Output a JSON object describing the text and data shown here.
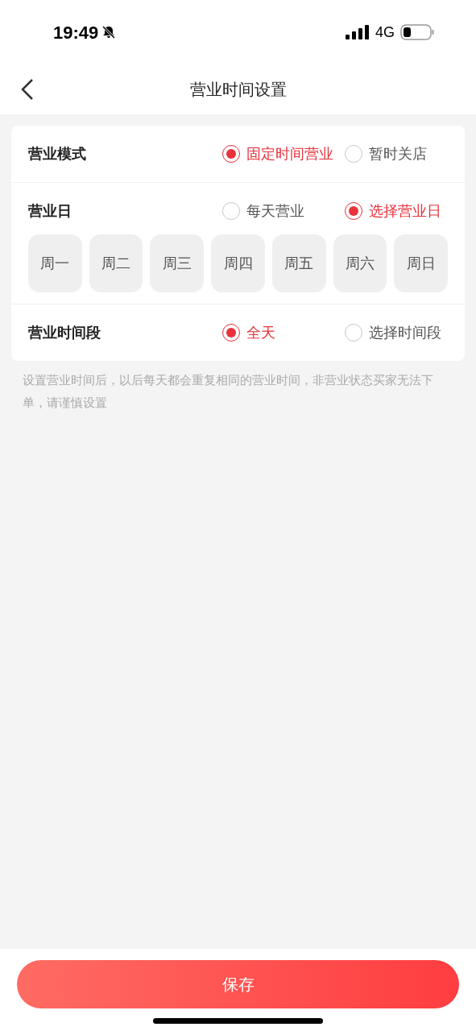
{
  "status_bar": {
    "time": "19:49",
    "network": "4G"
  },
  "header": {
    "title": "营业时间设置"
  },
  "settings": [
    {
      "label": "营业模式",
      "options": [
        {
          "label": "固定时间营业",
          "selected": true
        },
        {
          "label": "暂时关店",
          "selected": false
        }
      ]
    },
    {
      "label": "营业日",
      "options": [
        {
          "label": "每天营业",
          "selected": false
        },
        {
          "label": "选择营业日",
          "selected": true
        }
      ],
      "days": [
        {
          "label": "周一",
          "selected": false
        },
        {
          "label": "周二",
          "selected": false
        },
        {
          "label": "周三",
          "selected": false
        },
        {
          "label": "周四",
          "selected": false
        },
        {
          "label": "周五",
          "selected": false
        },
        {
          "label": "周六",
          "selected": false
        },
        {
          "label": "周日",
          "selected": false
        }
      ]
    },
    {
      "label": "营业时间段",
      "options": [
        {
          "label": "全天",
          "selected": true
        },
        {
          "label": "选择时间段",
          "selected": false
        }
      ]
    }
  ],
  "note": "设置营业时间后，以后每天都会重复相同的营业时间，非营业状态买家无法下单，请谨慎设置",
  "save_button": "保存"
}
